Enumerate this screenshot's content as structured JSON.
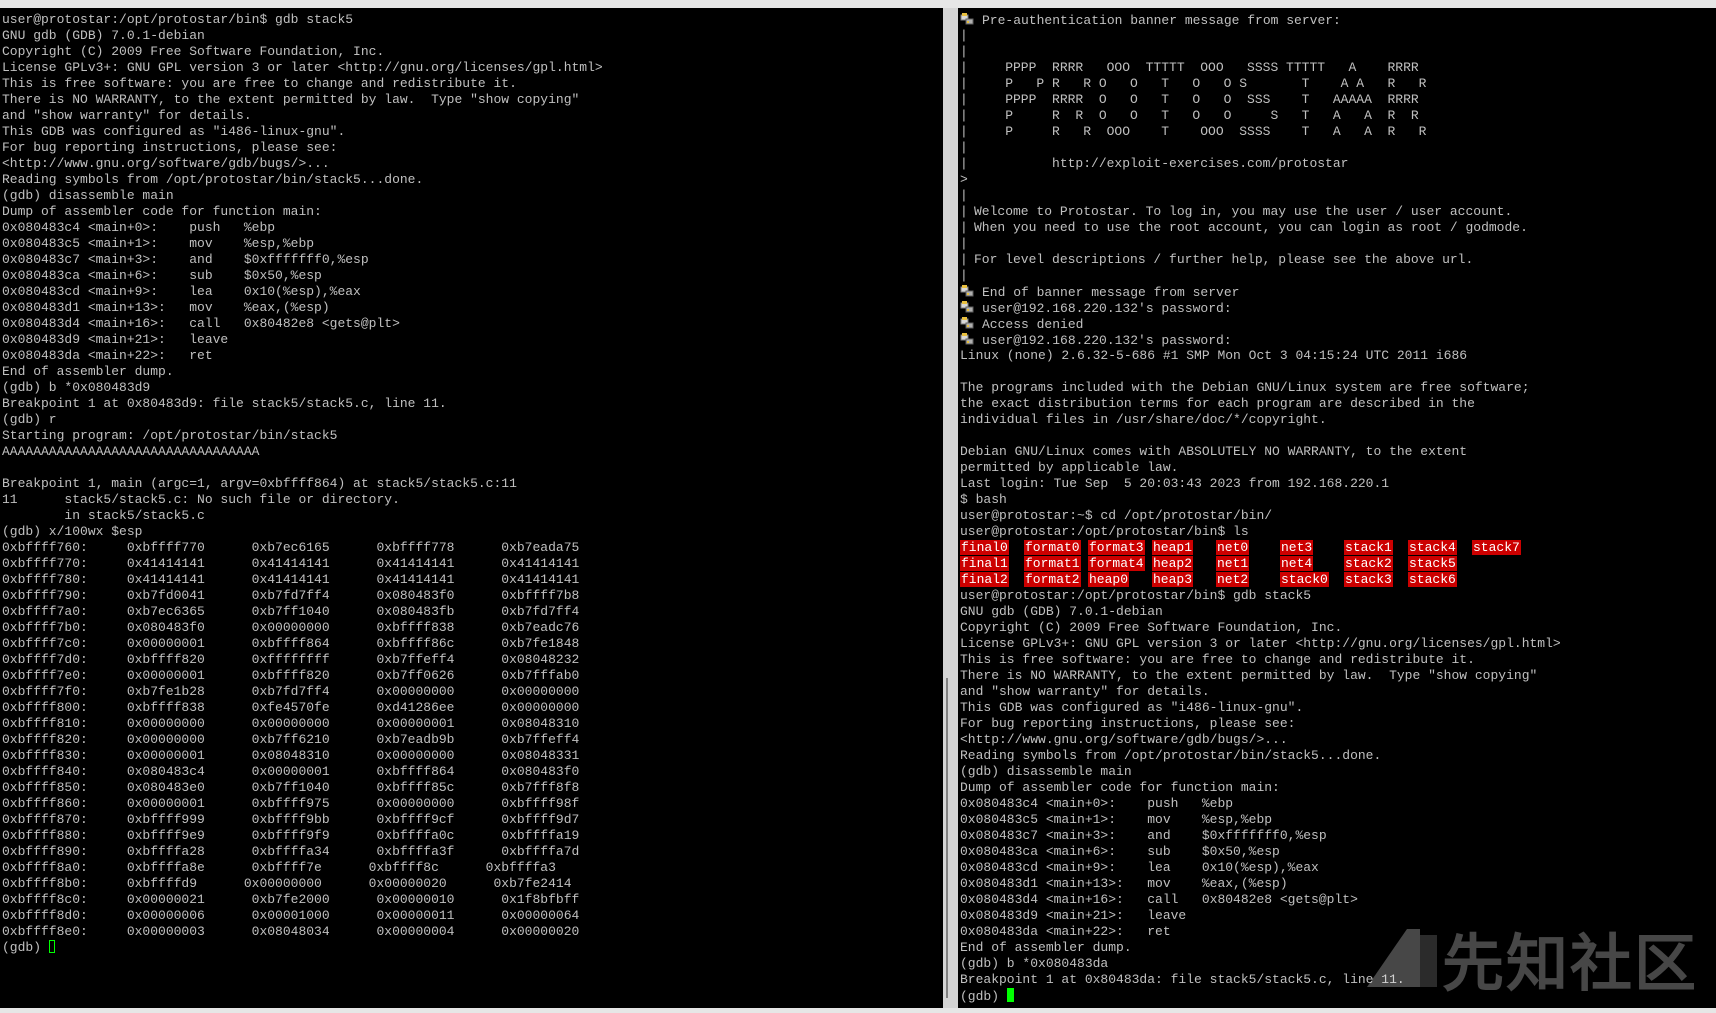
{
  "left_terminal": {
    "lines": [
      "user@protostar:/opt/protostar/bin$ gdb stack5",
      "GNU gdb (GDB) 7.0.1-debian",
      "Copyright (C) 2009 Free Software Foundation, Inc.",
      "License GPLv3+: GNU GPL version 3 or later <http://gnu.org/licenses/gpl.html>",
      "This is free software: you are free to change and redistribute it.",
      "There is NO WARRANTY, to the extent permitted by law.  Type \"show copying\"",
      "and \"show warranty\" for details.",
      "This GDB was configured as \"i486-linux-gnu\".",
      "For bug reporting instructions, please see:",
      "<http://www.gnu.org/software/gdb/bugs/>...",
      "Reading symbols from /opt/protostar/bin/stack5...done.",
      "(gdb) disassemble main",
      "Dump of assembler code for function main:",
      "0x080483c4 <main+0>:    push   %ebp",
      "0x080483c5 <main+1>:    mov    %esp,%ebp",
      "0x080483c7 <main+3>:    and    $0xfffffff0,%esp",
      "0x080483ca <main+6>:    sub    $0x50,%esp",
      "0x080483cd <main+9>:    lea    0x10(%esp),%eax",
      "0x080483d1 <main+13>:   mov    %eax,(%esp)",
      "0x080483d4 <main+16>:   call   0x80482e8 <gets@plt>",
      "0x080483d9 <main+21>:   leave",
      "0x080483da <main+22>:   ret",
      "End of assembler dump.",
      "(gdb) b *0x080483d9",
      "Breakpoint 1 at 0x80483d9: file stack5/stack5.c, line 11.",
      "(gdb) r",
      "Starting program: /opt/protostar/bin/stack5",
      "AAAAAAAAAAAAAAAAAAAAAAAAAAAAAAAAA",
      "",
      "Breakpoint 1, main (argc=1, argv=0xbffff864) at stack5/stack5.c:11",
      "11      stack5/stack5.c: No such file or directory.",
      "        in stack5/stack5.c",
      "(gdb) x/100wx $esp",
      "0xbffff760:     0xbffff770      0xb7ec6165      0xbffff778      0xb7eada75",
      "0xbffff770:     0x41414141      0x41414141      0x41414141      0x41414141",
      "0xbffff780:     0x41414141      0x41414141      0x41414141      0x41414141",
      "0xbffff790:     0xb7fd0041      0xb7fd7ff4      0x080483f0      0xbffff7b8",
      "0xbffff7a0:     0xb7ec6365      0xb7ff1040      0x080483fb      0xb7fd7ff4",
      "0xbffff7b0:     0x080483f0      0x00000000      0xbffff838      0xb7eadc76",
      "0xbffff7c0:     0x00000001      0xbffff864      0xbffff86c      0xb7fe1848",
      "0xbffff7d0:     0xbffff820      0xffffffff      0xb7ffeff4      0x08048232",
      "0xbffff7e0:     0x00000001      0xbffff820      0xb7ff0626      0xb7fffab0",
      "0xbffff7f0:     0xb7fe1b28      0xb7fd7ff4      0x00000000      0x00000000",
      "0xbffff800:     0xbffff838      0xfe4570fe      0xd41286ee      0x00000000",
      "0xbffff810:     0x00000000      0x00000000      0x00000001      0x08048310",
      "0xbffff820:     0x00000000      0xb7ff6210      0xb7eadb9b      0xb7ffeff4",
      "0xbffff830:     0x00000001      0x08048310      0x00000000      0x08048331",
      "0xbffff840:     0x080483c4      0x00000001      0xbffff864      0x080483f0",
      "0xbffff850:     0x080483e0      0xb7ff1040      0xbffff85c      0xb7fff8f8",
      "0xbffff860:     0x00000001      0xbffff975      0x00000000      0xbffff98f",
      "0xbffff870:     0xbffff999      0xbffff9bb      0xbffff9cf      0xbffff9d7",
      "0xbffff880:     0xbffff9e9      0xbffff9f9      0xbffffa0c      0xbffffa19",
      "0xbffff890:     0xbffffa28      0xbffffa34      0xbffffa3f      0xbffffa7d",
      "0xbffff8a0:     0xbffffa8e      0xbffff7e      0xbffff8c      0xbffffa3",
      "0xbffff8b0:     0xbffffd9      0x00000000      0x00000020      0xb7fe2414",
      "0xbffff8c0:     0x00000021      0xb7fe2000      0x00000010      0x1f8bfbff",
      "0xbffff8d0:     0x00000006      0x00001000      0x00000011      0x00000064",
      "0xbffff8e0:     0x00000003      0x08048034      0x00000004      0x00000020"
    ],
    "prompt": "(gdb) "
  },
  "right_terminal": {
    "banner_lines": [
      {
        "prefix": "key",
        "text": "Pre-authentication banner message from server:"
      },
      {
        "prefix": "|",
        "text": ""
      },
      {
        "prefix": "|",
        "text": ""
      },
      {
        "prefix": "|",
        "text": "    PPPP  RRRR   OOO  TTTTT  OOO   SSSS TTTTT   A    RRRR"
      },
      {
        "prefix": "|",
        "text": "    P   P R   R O   O   T   O   O S       T    A A   R   R"
      },
      {
        "prefix": "|",
        "text": "    PPPP  RRRR  O   O   T   O   O  SSS    T   AAAAA  RRRR"
      },
      {
        "prefix": "|",
        "text": "    P     R  R  O   O   T   O   O     S   T   A   A  R  R"
      },
      {
        "prefix": "|",
        "text": "    P     R   R  OOO    T    OOO  SSSS    T   A   A  R   R"
      },
      {
        "prefix": "|",
        "text": ""
      },
      {
        "prefix": "|",
        "text": "          http://exploit-exercises.com/protostar"
      },
      {
        "prefix": ">",
        "text": ""
      },
      {
        "prefix": "|",
        "text": ""
      },
      {
        "prefix": "|",
        "text": "Welcome to Protostar. To log in, you may use the user / user account."
      },
      {
        "prefix": "|",
        "text": "When you need to use the root account, you can login as root / godmode."
      },
      {
        "prefix": "|",
        "text": ""
      },
      {
        "prefix": "|",
        "text": "For level descriptions / further help, please see the above url."
      },
      {
        "prefix": "|",
        "text": ""
      },
      {
        "prefix": "key",
        "text": "End of banner message from server"
      },
      {
        "prefix": "key",
        "text": "user@192.168.220.132's password:"
      },
      {
        "prefix": "key",
        "text": "Access denied"
      },
      {
        "prefix": "key",
        "text": "user@192.168.220.132's password:"
      }
    ],
    "lines_before_ls": [
      "Linux (none) 2.6.32-5-686 #1 SMP Mon Oct 3 04:15:24 UTC 2011 i686",
      "",
      "The programs included with the Debian GNU/Linux system are free software;",
      "the exact distribution terms for each program are described in the",
      "individual files in /usr/share/doc/*/copyright.",
      "",
      "Debian GNU/Linux comes with ABSOLUTELY NO WARRANTY, to the extent",
      "permitted by applicable law.",
      "Last login: Tue Sep  5 20:03:43 2023 from 192.168.220.1",
      "$ bash",
      "user@protostar:~$ cd /opt/protostar/bin/",
      "user@protostar:/opt/protostar/bin$ ls"
    ],
    "ls_rows": [
      [
        "final0",
        "format0",
        "format3",
        "heap1",
        "net0",
        "net3",
        "stack1",
        "stack4",
        "stack7"
      ],
      [
        "final1",
        "format1",
        "format4",
        "heap2",
        "net1",
        "net4",
        "stack2",
        "stack5",
        ""
      ],
      [
        "final2",
        "format2",
        "heap0",
        "heap3",
        "net2",
        "stack0",
        "stack3",
        "stack6",
        ""
      ]
    ],
    "lines_after_ls": [
      "user@protostar:/opt/protostar/bin$ gdb stack5",
      "GNU gdb (GDB) 7.0.1-debian",
      "Copyright (C) 2009 Free Software Foundation, Inc.",
      "License GPLv3+: GNU GPL version 3 or later <http://gnu.org/licenses/gpl.html>",
      "This is free software: you are free to change and redistribute it.",
      "There is NO WARRANTY, to the extent permitted by law.  Type \"show copying\"",
      "and \"show warranty\" for details.",
      "This GDB was configured as \"i486-linux-gnu\".",
      "For bug reporting instructions, please see:",
      "<http://www.gnu.org/software/gdb/bugs/>...",
      "Reading symbols from /opt/protostar/bin/stack5...done.",
      "(gdb) disassemble main",
      "Dump of assembler code for function main:",
      "0x080483c4 <main+0>:    push   %ebp",
      "0x080483c5 <main+1>:    mov    %esp,%ebp",
      "0x080483c7 <main+3>:    and    $0xfffffff0,%esp",
      "0x080483ca <main+6>:    sub    $0x50,%esp",
      "0x080483cd <main+9>:    lea    0x10(%esp),%eax",
      "0x080483d1 <main+13>:   mov    %eax,(%esp)",
      "0x080483d4 <main+16>:   call   0x80482e8 <gets@plt>",
      "0x080483d9 <main+21>:   leave",
      "0x080483da <main+22>:   ret",
      "End of assembler dump.",
      "(gdb) b *0x080483da",
      "Breakpoint 1 at 0x80483da: file stack5/stack5.c, line 11."
    ],
    "prompt": "(gdb) "
  },
  "watermark": {
    "text": "先知社区"
  },
  "colors": {
    "terminal_bg": "#000000",
    "terminal_fg": "#c0c0c0",
    "ls_highlight_bg": "#cc0000",
    "cursor": "#00ff00"
  }
}
